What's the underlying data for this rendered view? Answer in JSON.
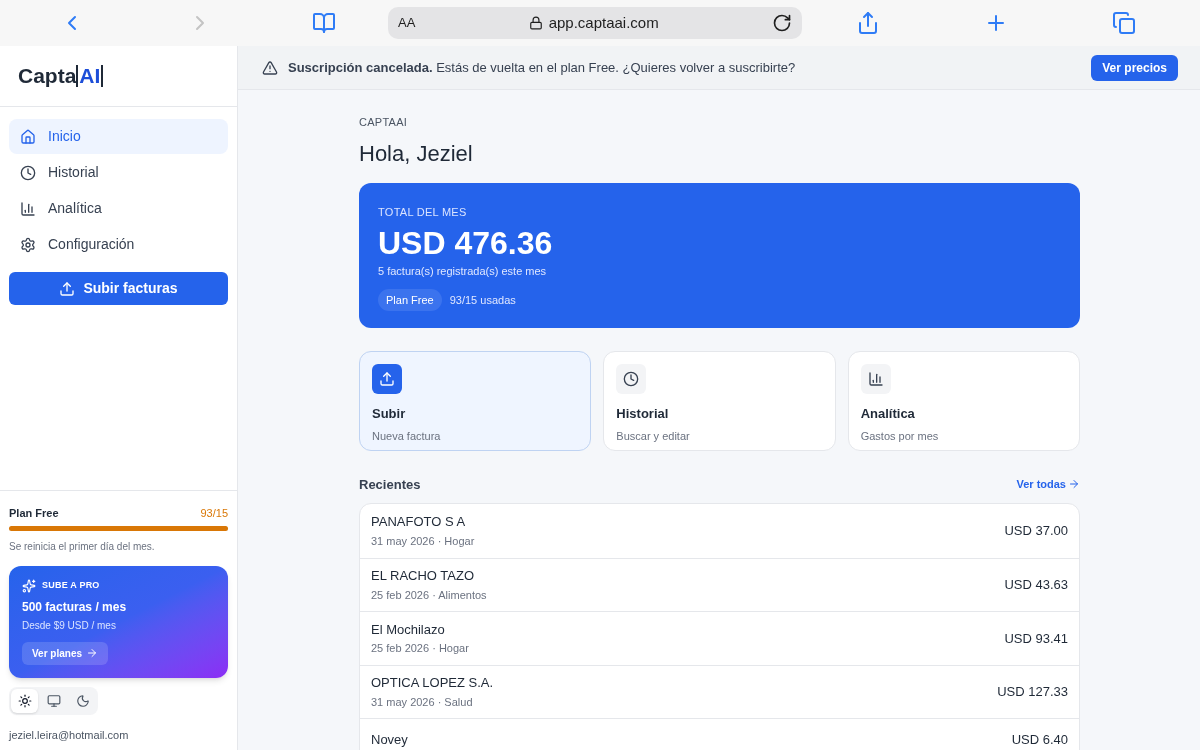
{
  "browser": {
    "text_size": "AA",
    "url": "app.captaai.com"
  },
  "sidebar": {
    "logo": {
      "prefix": "Capta",
      "boxed": "AI"
    },
    "items": [
      {
        "label": "Inicio",
        "kind": "home",
        "selected": true
      },
      {
        "label": "Historial",
        "kind": "clock",
        "selected": false
      },
      {
        "label": "Analítica",
        "kind": "chart",
        "selected": false
      },
      {
        "label": "Configuración",
        "kind": "gear",
        "selected": false
      }
    ],
    "upload_button": "Subir facturas",
    "plan": {
      "name": "Plan Free",
      "usage": "93/15",
      "level": 1,
      "note": "Se reinicia el primer día del mes."
    },
    "promo": {
      "eyebrow": "SUBE A PRO",
      "title": "500 facturas / mes",
      "price": "Desde $9 USD / mes",
      "button": "Ver planes"
    },
    "themes": [
      {
        "kind": "sun",
        "selected": true
      },
      {
        "kind": "monitor",
        "selected": false
      },
      {
        "kind": "moon",
        "selected": false
      }
    ],
    "email": "jeziel.leira@hotmail.com"
  },
  "banner": {
    "text": "**Suscripción cancelada.** Estás de vuelta en el plan Free. ¿Quieres volver a suscribirte?",
    "button": "Ver precios"
  },
  "main": {
    "eyebrow": "CAPTAAI",
    "greeting": "Hola, Jeziel",
    "total": {
      "label": "TOTAL DEL MES",
      "amount": "USD 476.36",
      "note": "5 factura(s) registrada(s) este mes",
      "plan_badge": "Plan Free",
      "usage": "93/15 usadas"
    },
    "actions": [
      {
        "title": "Subir",
        "subtitle": "Nueva factura",
        "kind": "upload",
        "selected": true
      },
      {
        "title": "Historial",
        "subtitle": "Buscar y editar",
        "kind": "clock",
        "selected": false
      },
      {
        "title": "Analítica",
        "subtitle": "Gastos por mes",
        "kind": "chart",
        "selected": false
      }
    ],
    "recent_title": "Recientes",
    "see_all": "Ver todas",
    "recent": [
      {
        "name": "PANAFOTO S A",
        "meta": "31 may 2026 · Hogar",
        "amount": "USD 37.00"
      },
      {
        "name": "EL RACHO TAZO",
        "meta": "25 feb 2026 · Alimentos",
        "amount": "USD 43.63"
      },
      {
        "name": "El Mochilazo",
        "meta": "25 feb 2026 · Hogar",
        "amount": "USD 93.41"
      },
      {
        "name": "OPTICA LOPEZ S.A.",
        "meta": "31 may 2026 · Salud",
        "amount": "USD 127.33"
      },
      {
        "name": "Novey",
        "amount": "USD 6.40"
      }
    ]
  }
}
